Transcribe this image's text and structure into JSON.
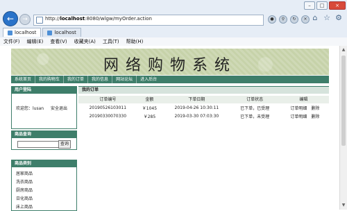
{
  "browser": {
    "url_prefix": "http://",
    "url_host": "localhost",
    "url_rest": ":8080/wlgw/myOrder.action",
    "tabs": [
      {
        "label": "localhost"
      },
      {
        "label": "localhost"
      }
    ],
    "menu": [
      "文件(F)",
      "编辑(E)",
      "查看(V)",
      "收藏夹(A)",
      "工具(T)",
      "帮助(H)"
    ],
    "window_buttons": [
      "–",
      "□",
      "×"
    ]
  },
  "site": {
    "title": "网络购物系统",
    "nav": [
      "系统首页",
      "我的购物车",
      "我的订单",
      "我的信息",
      "网站论坛",
      "进入后台"
    ]
  },
  "login_box": {
    "header": "用户登陆",
    "welcome": "欢迎您：lusan",
    "logout": "安全退出"
  },
  "search_box": {
    "header": "商品查询",
    "button": "查询",
    "value": ""
  },
  "category_box": {
    "header": "商品类别",
    "items": [
      "居家商品",
      "洗衣商品",
      "厨房商品",
      "日化商品",
      "床上商品"
    ]
  },
  "orders": {
    "header": "我的订单",
    "columns": [
      "订单编号",
      "金额",
      "下单日期",
      "订单状态",
      "编辑"
    ],
    "rows": [
      {
        "id": "20190526103011",
        "amount": "￥1045",
        "date": "2019-04-26 10:30:11",
        "status": "已下单，已受理",
        "detail": "订单明细",
        "delete": "删除"
      },
      {
        "id": "20190330070330",
        "amount": "￥285",
        "date": "2019-03-30 07:03:30",
        "status": "已下单，未受理",
        "detail": "订单明细",
        "delete": "删除"
      }
    ]
  }
}
